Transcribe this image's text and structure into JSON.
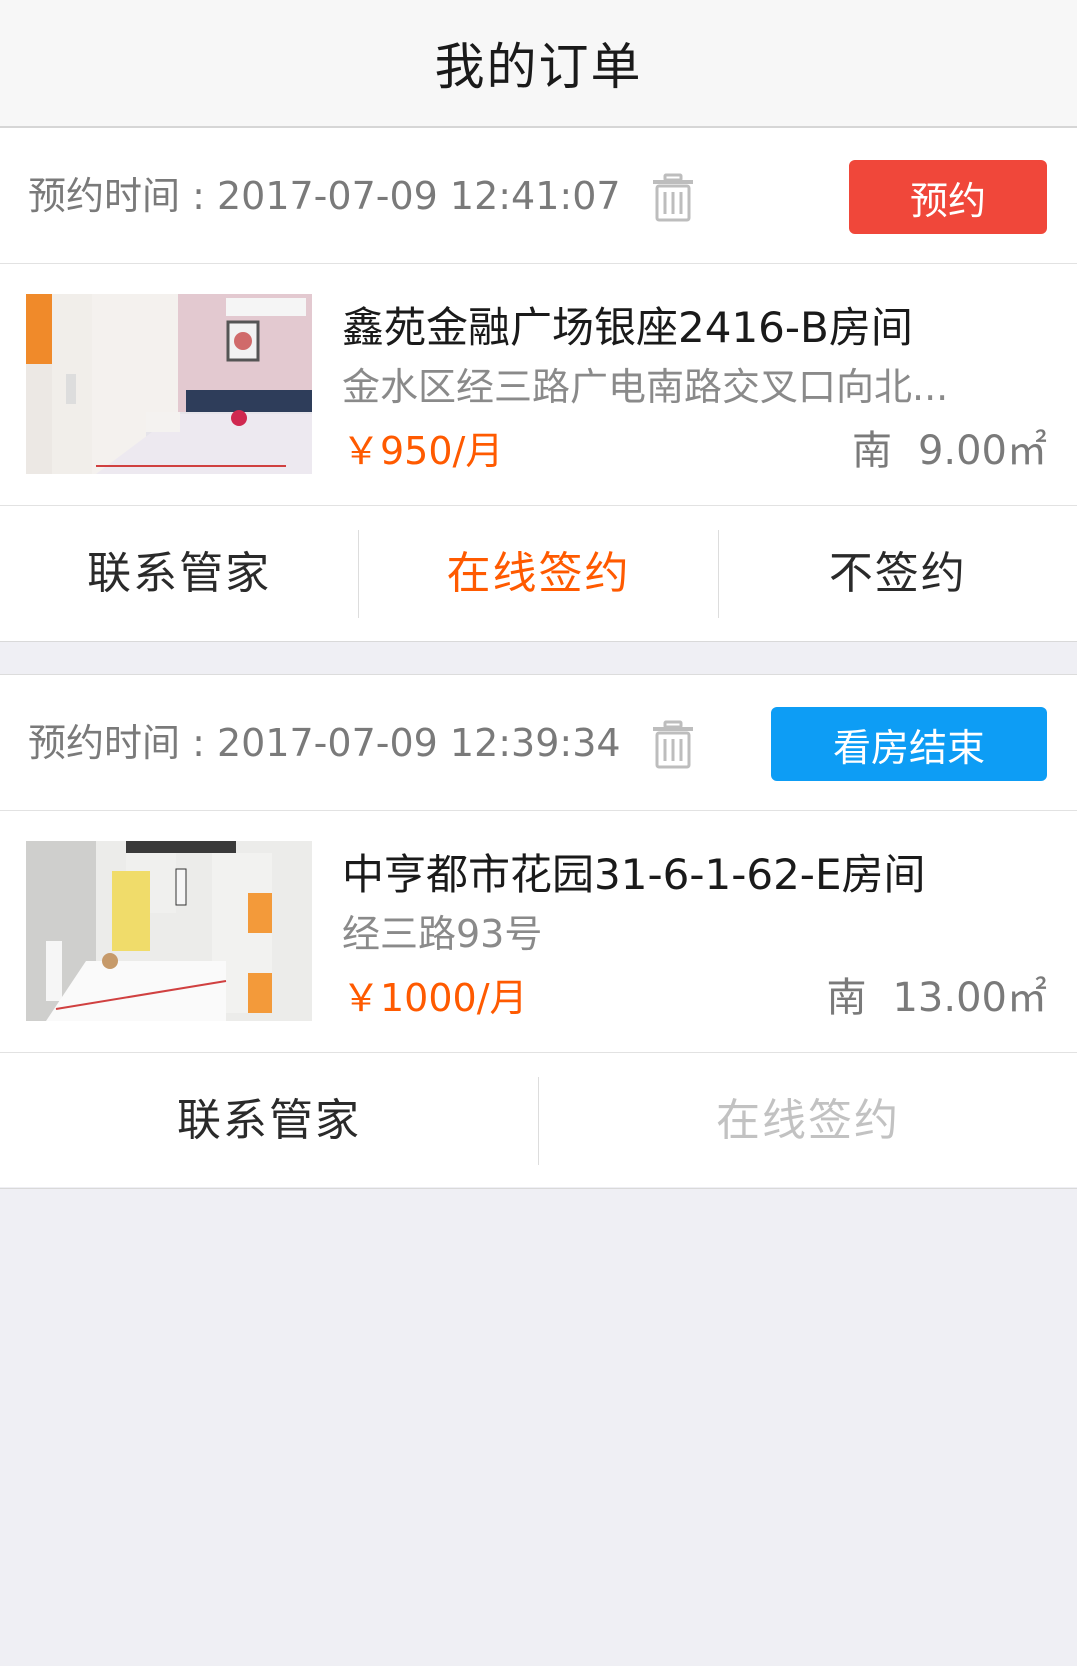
{
  "header": {
    "title": "我的订单"
  },
  "orders": [
    {
      "time_label": "预约时间 : ",
      "time": "2017-07-09 12:41:07",
      "status_button": "预约",
      "status_color": "#f0473a",
      "room_name": "鑫苑金融广场银座2416-B房间",
      "address": "金水区经三路广电南路交叉口向北...",
      "price": "￥950/月",
      "direction": "南",
      "area": "9.00㎡",
      "actions": [
        "联系管家",
        "在线签约",
        "不签约"
      ]
    },
    {
      "time_label": "预约时间 : ",
      "time": "2017-07-09 12:39:34",
      "status_button": "看房结束",
      "status_color": "#0d9df5",
      "room_name": "中亨都市花园31-6-1-62-E房间",
      "address": "经三路93号",
      "price": "￥1000/月",
      "direction": "南",
      "area": "13.00㎡",
      "actions": [
        "联系管家",
        "在线签约"
      ]
    }
  ],
  "colors": {
    "accent_orange": "#ff5a00",
    "reserve_red": "#f0473a",
    "finished_blue": "#0d9df5",
    "disabled_gray": "#c2c2c2"
  },
  "icons": {
    "delete": "trash-icon"
  }
}
